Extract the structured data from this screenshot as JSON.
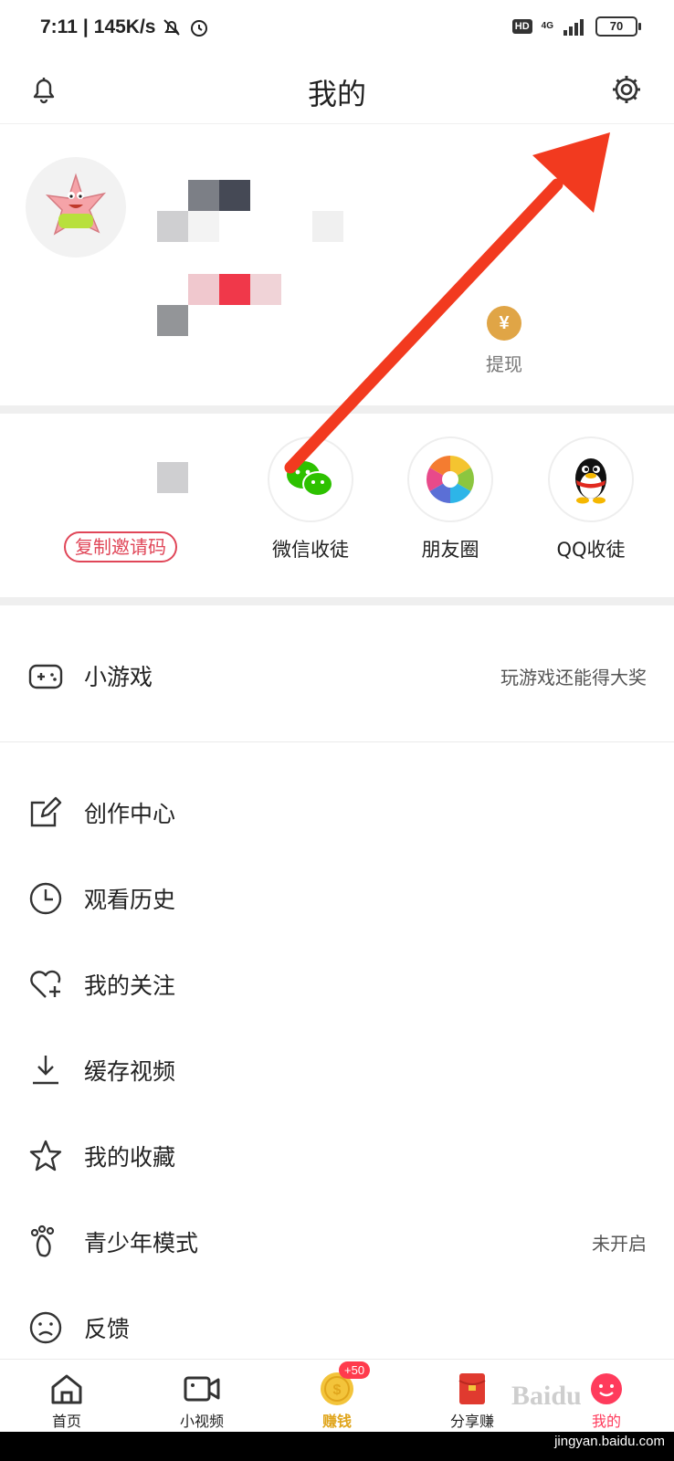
{
  "status_bar": {
    "time": "7:11",
    "speed": "145K/s",
    "hd": "HD",
    "network": "4G",
    "battery": "70"
  },
  "header": {
    "title": "我的",
    "left_icon": "bell-icon",
    "right_icon": "settings-gear-icon"
  },
  "profile": {
    "withdraw_label": "提现",
    "withdraw_symbol": "¥",
    "withdraw_color": "#e0a546"
  },
  "invite": {
    "copy_code_label": "复制邀请码",
    "share_items": [
      {
        "label": "微信收徒",
        "icon": "wechat-icon"
      },
      {
        "label": "朋友圈",
        "icon": "moments-aperture-icon"
      },
      {
        "label": "QQ收徒",
        "icon": "qq-penguin-icon"
      }
    ]
  },
  "menu": {
    "mini_games": {
      "label": "小游戏",
      "extra": "玩游戏还能得大奖",
      "icon": "gamepad-icon"
    },
    "items": [
      {
        "label": "创作中心",
        "extra": "",
        "icon": "edit-icon"
      },
      {
        "label": "观看历史",
        "extra": "",
        "icon": "clock-icon"
      },
      {
        "label": "我的关注",
        "extra": "",
        "icon": "heart-plus-icon"
      },
      {
        "label": "缓存视频",
        "extra": "",
        "icon": "download-icon"
      },
      {
        "label": "我的收藏",
        "extra": "",
        "icon": "star-icon"
      },
      {
        "label": "青少年模式",
        "extra": "未开启",
        "icon": "footprint-icon"
      },
      {
        "label": "反馈",
        "extra": "",
        "icon": "sad-face-icon"
      }
    ]
  },
  "tabbar": {
    "tabs": [
      {
        "label": "首页",
        "icon": "home-icon"
      },
      {
        "label": "小视频",
        "icon": "video-camera-icon"
      },
      {
        "label": "赚钱",
        "icon": "coin-icon",
        "badge": "+50"
      },
      {
        "label": "分享赚",
        "icon": "red-envelope-icon"
      },
      {
        "label": "我的",
        "icon": "smiley-avatar-icon"
      }
    ]
  },
  "watermark": {
    "logo": "Baidu",
    "site": "jingyan.baidu.com"
  },
  "colors": {
    "accent": "#e04658",
    "coin": "#f3c43b",
    "arrow": "#f23a1f",
    "wechat": "#2dc100"
  }
}
